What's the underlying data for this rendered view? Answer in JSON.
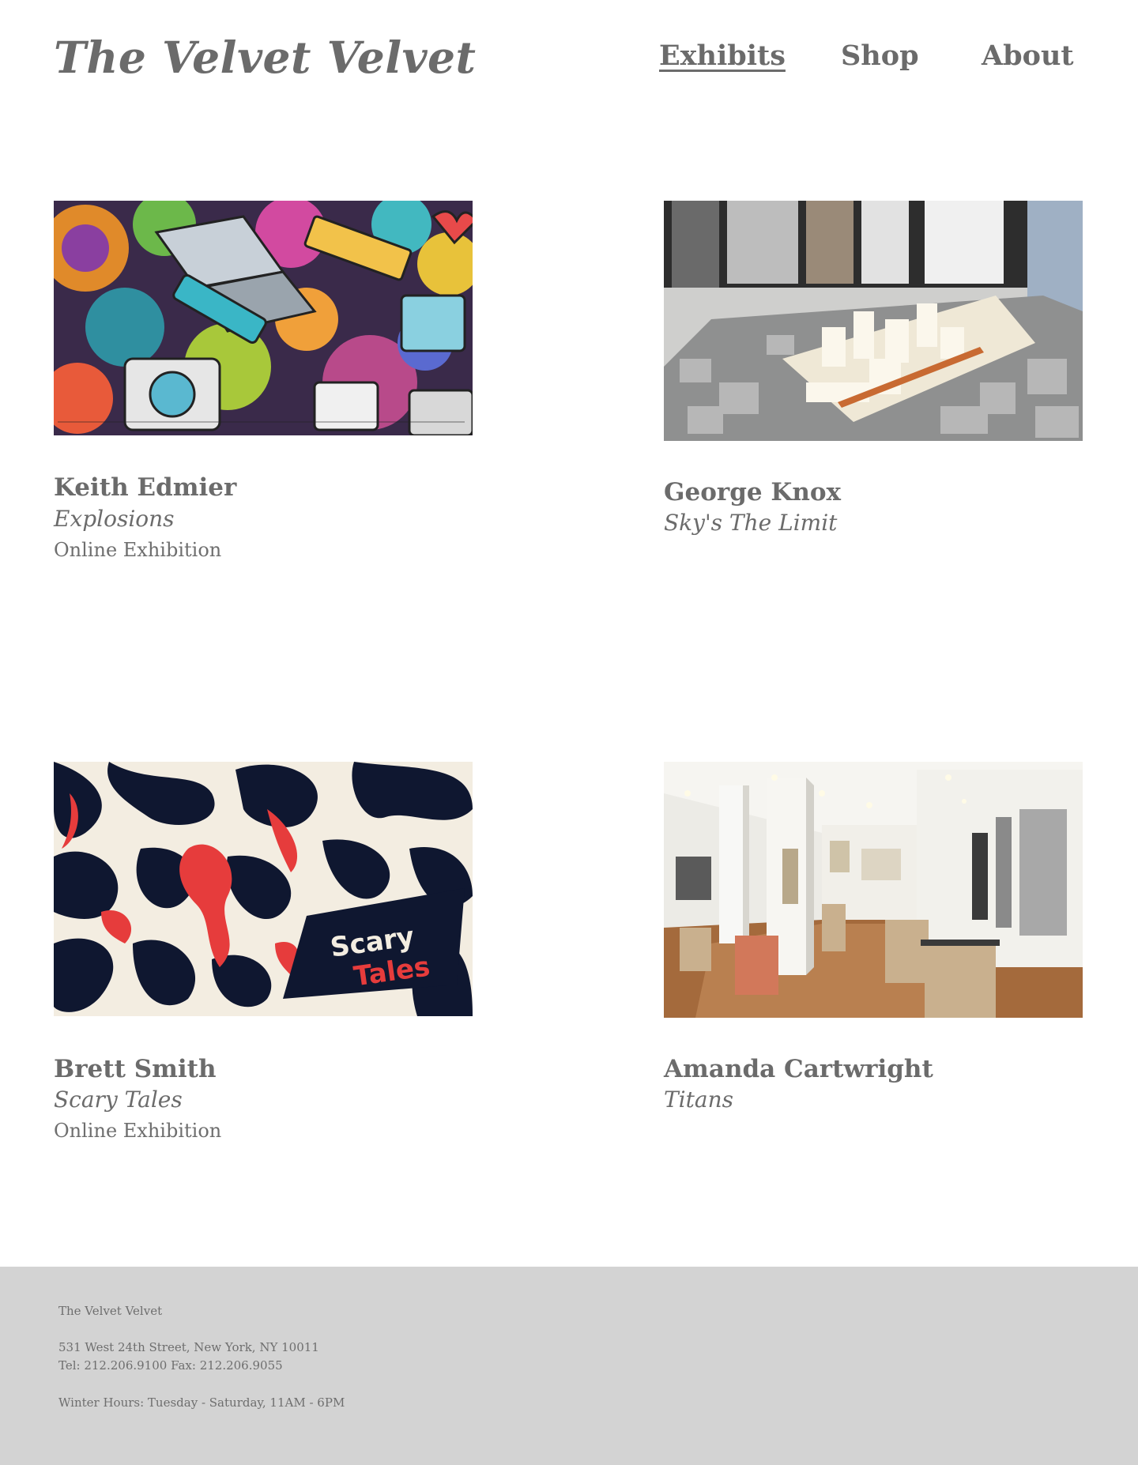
{
  "header": {
    "site_title": "The Velvet Velvet",
    "nav": [
      {
        "label": "Exhibits",
        "active": true
      },
      {
        "label": "Shop",
        "active": false
      },
      {
        "label": "About",
        "active": false
      }
    ]
  },
  "exhibits": [
    {
      "artist": "Keith Edmier",
      "title": "Explosions",
      "type": "Online Exhibition",
      "image": "colorful-doodle-illustration"
    },
    {
      "artist": "George Knox",
      "title": "Sky's The Limit",
      "type": "",
      "image": "architectural-city-model"
    },
    {
      "artist": "Brett Smith",
      "title": "Scary Tales",
      "type": "Online Exhibition",
      "image": "scary-tales-marbled-artwork",
      "image_text_1": "Scary",
      "image_text_2": "Tales"
    },
    {
      "artist": "Amanda Cartwright",
      "title": "Titans",
      "type": "",
      "image": "gallery-interior-photo"
    }
  ],
  "footer": {
    "name": "The Velvet Velvet",
    "address": "531 West 24th Street, New York, NY 10011",
    "phone": "Tel: 212.206.9100 Fax: 212.206.9055",
    "hours": "Winter Hours: Tuesday - Saturday, 11AM - 6PM"
  },
  "colors": {
    "text": "#6b6b6b",
    "footer_bg": "#d3d3d3",
    "scary_navy": "#0f1730",
    "scary_red": "#e63c3c",
    "scary_cream": "#f3ede1"
  }
}
